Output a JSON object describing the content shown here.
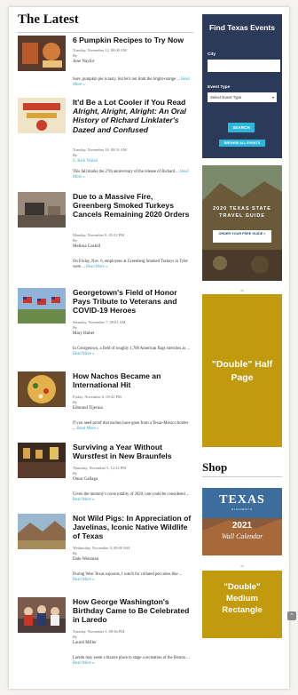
{
  "section_title": "The Latest",
  "articles": [
    {
      "title": "6 Pumpkin Recipes to Try Now",
      "date": "Tuesday, November 12, 08:00 AM",
      "by": "By",
      "author": "June Naylor",
      "excerpt": "Sure, pumpkin pie is tasty. but let's not limit the bright-orange ...",
      "read_more": "Read More »"
    },
    {
      "title_a": "It'd Be a Lot Cooler if You Read",
      "title_b": "Alright, Alright, Alright: An Oral History of Richard Linklater's Dazed and Confused",
      "date": "Tuesday, November 10, 09:51 AM",
      "by": "By",
      "author": "S. Kirk Walsh",
      "excerpt": "This fall marks the 27th anniversary of the release of Richard ...",
      "read_more": "Read More »"
    },
    {
      "title": "Due to a Massive Fire, Greenberg Smoked Turkeys Cancels Remaining 2020 Orders",
      "date": "Monday, November 9, 05:32 PM",
      "by": "By",
      "author": "Melissa Gaskill",
      "excerpt": "On Friday, Nov. 6, employees at Greenberg Smoked Turkeys in Tyler were ...",
      "read_more": "Read More »"
    },
    {
      "title": "Georgetown's Field of Honor Pays Tribute to Veterans and COVID-19 Heroes",
      "date": "Saturday, November 7, 09:01 AM",
      "by": "By",
      "author": "Mary Huber",
      "excerpt": "In Georgetown, a field of roughly 1,700 American flags stretches as ...",
      "read_more": "Read More »"
    },
    {
      "title": "How Nachos Became an International Hit",
      "date": "Friday, November 6, 09:42 PM",
      "by": "By",
      "author": "Edmund Tijerina",
      "excerpt": "If you need proof that nachos have gone from a Texas-Mexico border ...",
      "read_more": "Read More »"
    },
    {
      "title": "Surviving a Year Without Wurstfest in New Braunfels",
      "date": "Thursday, November 5, 12:32 PM",
      "by": "By",
      "author": "Omar Gallaga",
      "excerpt": "Given the mummy's curse totality of 2020, one could be considered ...",
      "read_more": "Read More »"
    },
    {
      "title": "Not Wild Pigs: In Appreciation of Javelinas, Iconic Native Wildlife of Texas",
      "date": "Wednesday, November 4, 08:00 AM",
      "by": "By",
      "author": "Dale Weisman",
      "excerpt": "During West Texas sojourns, I watch for collared peccaries like ...",
      "read_more": "Read More »"
    },
    {
      "title": "How George Washington's Birthday Came to Be Celebrated in Laredo",
      "date": "Tuesday, November 3, 09:36 PM",
      "by": "By",
      "author": "Laurel Miller",
      "excerpt": "Laredo may seem a bizarre place to stage a recreation of the Boston ...",
      "read_more": "Read More »"
    }
  ],
  "find_events": {
    "title": "Find Texas Events",
    "city_label": "City",
    "city_value": "",
    "type_label": "Event Type",
    "type_selected": "Select Event Type",
    "search_label": "SEARCH",
    "browse_label": "BROWSE ALL EVENTS"
  },
  "travel_guide": {
    "text": "2020 TEXAS STATE TRAVEL GUIDE",
    "order_label": "ORDER YOUR FREE GUIDE »"
  },
  "ads": {
    "half_page": "\"Double\" Half Page",
    "medium_rect": "\"Double\" Medium Rectangle",
    "mark": "AD"
  },
  "shop": {
    "title": "Shop",
    "calendar_brand": "TEXAS",
    "calendar_sub": "HIGHWAYS",
    "calendar_year": "2021",
    "calendar_name": "Wall Calendar"
  },
  "colors": {
    "accent": "#3aa7c7",
    "events_bg": "#2b3a59",
    "ad_gold": "#c29a0e"
  }
}
